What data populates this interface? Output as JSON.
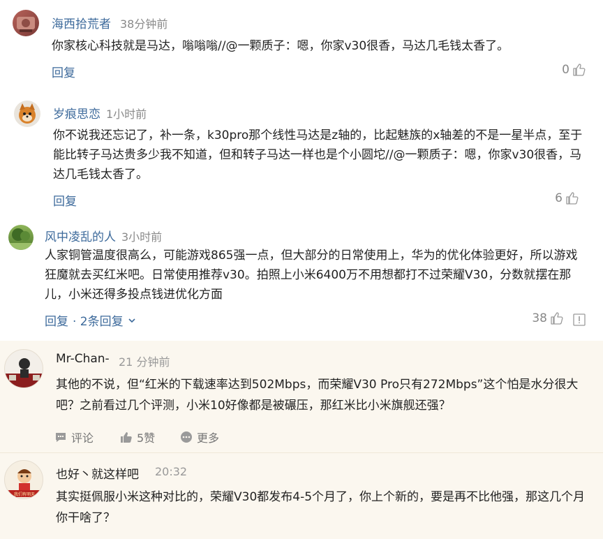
{
  "comments": [
    {
      "username": "海西拾荒者",
      "time": "38分钟前",
      "text": "你家核心科技就是马达，嗡嗡嗡//@一颗质子：嗯，你家v30很香，马达几毛钱太香了。",
      "reply": "回复",
      "likes": "0"
    },
    {
      "username": "岁痕思恋",
      "time": "1小时前",
      "text": "你不说我还忘记了，补一条，k30pro那个线性马达是z轴的，比起魅族的x轴差的不是一星半点，至于能比转子马达贵多少我不知道，但和转子马达一样也是个小圆坨//@一颗质子：嗯，你家v30很香，马达几毛钱太香了。",
      "reply": "回复",
      "likes": "6"
    },
    {
      "username": "风中凌乱的人",
      "time": "3小时前",
      "text": "人家铜管温度很高么，可能游戏865强一点，但大部分的日常使用上，华为的优化体验更好，所以游戏狂魔就去买红米吧。日常使用推荐v30。拍照上小米6400万不用想都打不过荣耀V30，分数就摆在那儿，小米还得多投点钱进优化方面",
      "reply": "回复",
      "replies_link": "· 2条回复",
      "likes": "38"
    }
  ],
  "quoted": [
    {
      "username": "Mr-Chan-",
      "time": "21 分钟前",
      "text": "其他的不说，但“红米的下载速率达到502Mbps，而荣耀V30 Pro只有272Mbps”这个怕是水分很大吧？之前看过几个评测，小米10好像都是被碾压，那红米比小米旗舰还强？",
      "comment_label": "评论",
      "like_label": "5赞",
      "more_label": "更多"
    },
    {
      "username": "也好丶就这样吧",
      "time": "20:32",
      "text": "其实挺佩服小米这种对比的，荣耀V30都发布4-5个月了，你上个新的，要是再不比他强，那这几个月你干啥了？",
      "avatar_text": "我们有明天"
    }
  ],
  "colors": {
    "link": "#3d6a9b",
    "quoted_bg": "#fbf7ef",
    "muted": "#8a8a8a"
  }
}
